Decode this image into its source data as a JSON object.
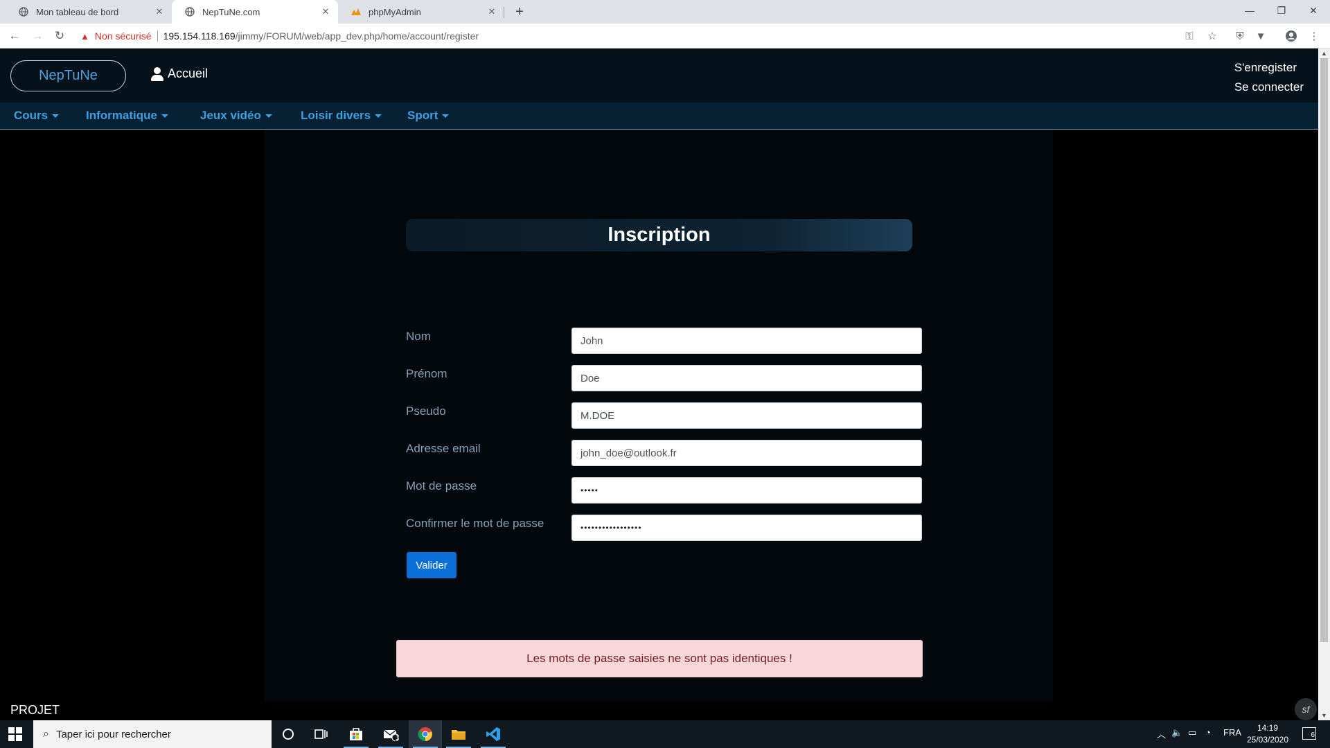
{
  "browser": {
    "tabs": [
      {
        "title": "Mon tableau de bord",
        "active": false
      },
      {
        "title": "NepTuNe.com",
        "active": true
      },
      {
        "title": "phpMyAdmin",
        "active": false
      }
    ],
    "security_label": "Non sécurisé",
    "url_host": "195.154.118.169",
    "url_path": "/jimmy/FORUM/web/app_dev.php/home/account/register"
  },
  "site": {
    "brand": "NepTuNe",
    "home_link": "Accueil",
    "auth": {
      "register": "S'enregister",
      "login": "Se connecter"
    },
    "nav": [
      {
        "label": "Cours"
      },
      {
        "label": "Informatique"
      },
      {
        "label": "Jeux vidéo"
      },
      {
        "label": "Loisir divers"
      },
      {
        "label": "Sport"
      }
    ]
  },
  "form": {
    "title": "Inscription",
    "fields": [
      {
        "label": "Nom",
        "value": "John"
      },
      {
        "label": "Prénom",
        "value": "Doe"
      },
      {
        "label": "Pseudo",
        "value": "M.DOE"
      },
      {
        "label": "Adresse email",
        "value": "john_doe@outlook.fr"
      },
      {
        "label": "Mot de passe",
        "value": "•••••"
      },
      {
        "label": "Confirmer le mot de passe",
        "value": "•••••••••••••••••"
      }
    ],
    "submit_label": "Valider",
    "error_message": "Les mots de passe saisies ne sont pas identiques !"
  },
  "footer": {
    "label": "PROJET"
  },
  "taskbar": {
    "search_placeholder": "Taper ici pour rechercher",
    "language": "FRA",
    "time": "14:19",
    "date": "25/03/2020",
    "notification_count": "6",
    "mail_badge": "1"
  },
  "colors": {
    "accent_blue": "#3ea0e0",
    "header_bg": "#06121b",
    "nav_bg": "#062133",
    "button_blue": "#0a6fd8",
    "alert_bg": "#f8d7da",
    "alert_text": "#721c24"
  }
}
